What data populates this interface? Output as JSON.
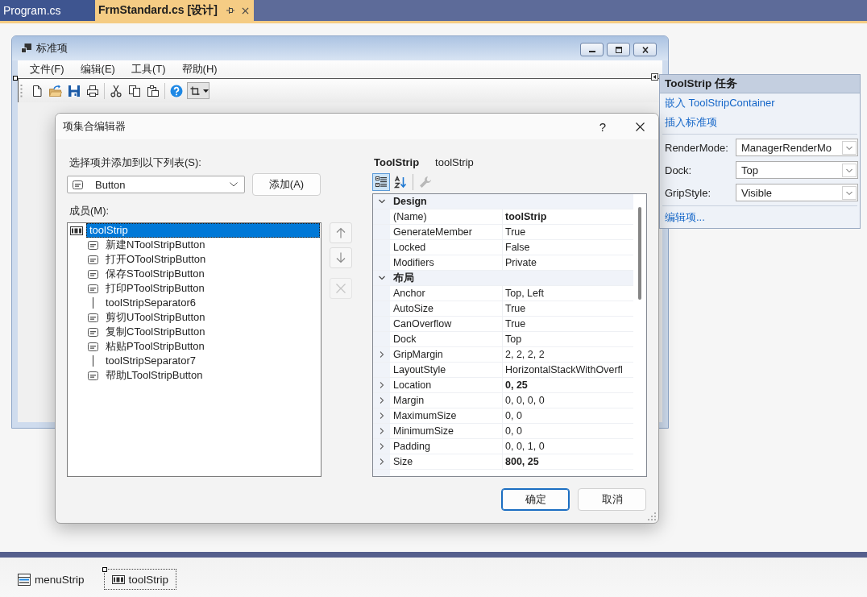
{
  "editor_tabs": [
    {
      "label": "Program.cs",
      "selected": false
    },
    {
      "label": "FrmStandard.cs [设计]",
      "selected": true
    }
  ],
  "form": {
    "title": "标准项",
    "menu": [
      "文件(F)",
      "编辑(E)",
      "工具(T)",
      "帮助(H)"
    ]
  },
  "smart_tag_panel": {
    "title": "ToolStrip 任务",
    "actions": [
      "嵌入 ToolStripContainer",
      "插入标准项"
    ],
    "properties": [
      {
        "label": "RenderMode:",
        "value": "ManagerRenderMo"
      },
      {
        "label": "Dock:",
        "value": "Top"
      },
      {
        "label": "GripStyle:",
        "value": "Visible"
      }
    ],
    "footer_action": "编辑项..."
  },
  "dialog": {
    "title": "项集合编辑器",
    "help_button": "?",
    "select_label": "选择项并添加到以下列表(S):",
    "item_type": "Button",
    "add_button": "添加(A)",
    "members_label": "成员(M):",
    "members": [
      {
        "label": "toolStrip",
        "kind": "toolstrip",
        "selected": true,
        "children": [
          {
            "label": "新建NToolStripButton",
            "kind": "button",
            "selected": false
          },
          {
            "label": "打开OToolStripButton",
            "kind": "button",
            "selected": false
          },
          {
            "label": "保存SToolStripButton",
            "kind": "button",
            "selected": false
          },
          {
            "label": "打印PToolStripButton",
            "kind": "button",
            "selected": false
          },
          {
            "label": "toolStripSeparator6",
            "kind": "separator",
            "selected": false
          },
          {
            "label": "剪切UToolStripButton",
            "kind": "button",
            "selected": false
          },
          {
            "label": "复制CToolStripButton",
            "kind": "button",
            "selected": false
          },
          {
            "label": "粘贴PToolStripButton",
            "kind": "button",
            "selected": false
          },
          {
            "label": "toolStripSeparator7",
            "kind": "separator",
            "selected": false
          },
          {
            "label": "帮助LToolStripButton",
            "kind": "button",
            "selected": false
          }
        ]
      }
    ],
    "member_buttons": [
      {
        "disabled": false
      },
      {
        "disabled": false
      },
      {
        "disabled": true
      }
    ],
    "component_type": "ToolStrip",
    "component_name": "toolStrip",
    "property_view_buttons": [
      {
        "selected": true
      },
      {
        "selected": false
      }
    ],
    "property_pages_button": {
      "disabled": true
    },
    "property_grid": [
      {
        "category": "Design",
        "expanded": true,
        "properties": [
          {
            "name": "(Name)",
            "value": "toolStrip",
            "modified": true,
            "expandable": false
          },
          {
            "name": "GenerateMember",
            "value": "True",
            "modified": false,
            "expandable": false
          },
          {
            "name": "Locked",
            "value": "False",
            "modified": false,
            "expandable": false
          },
          {
            "name": "Modifiers",
            "value": "Private",
            "modified": false,
            "expandable": false
          }
        ]
      },
      {
        "category": "布局",
        "expanded": true,
        "properties": [
          {
            "name": "Anchor",
            "value": "Top, Left",
            "modified": false,
            "expandable": false
          },
          {
            "name": "AutoSize",
            "value": "True",
            "modified": false,
            "expandable": false
          },
          {
            "name": "CanOverflow",
            "value": "True",
            "modified": false,
            "expandable": false
          },
          {
            "name": "Dock",
            "value": "Top",
            "modified": false,
            "expandable": false
          },
          {
            "name": "GripMargin",
            "value": "2, 2, 2, 2",
            "modified": false,
            "expandable": true
          },
          {
            "name": "LayoutStyle",
            "value": "HorizontalStackWithOverfl",
            "modified": false,
            "expandable": false
          },
          {
            "name": "Location",
            "value": "0, 25",
            "modified": true,
            "expandable": true
          },
          {
            "name": "Margin",
            "value": "0, 0, 0, 0",
            "modified": false,
            "expandable": true
          },
          {
            "name": "MaximumSize",
            "value": "0, 0",
            "modified": false,
            "expandable": true
          },
          {
            "name": "MinimumSize",
            "value": "0, 0",
            "modified": false,
            "expandable": true
          },
          {
            "name": "Padding",
            "value": "0, 0, 1, 0",
            "modified": false,
            "expandable": true
          },
          {
            "name": "Size",
            "value": "800, 25",
            "modified": true,
            "expandable": true
          }
        ]
      }
    ],
    "buttons": [
      {
        "label": "确定",
        "default": true
      },
      {
        "label": "取消",
        "default": false
      }
    ]
  },
  "component_tray": [
    {
      "label": "menuStrip",
      "kind": "menustrip",
      "selected": false
    },
    {
      "label": "toolStrip",
      "kind": "toolstrip",
      "selected": true
    }
  ]
}
